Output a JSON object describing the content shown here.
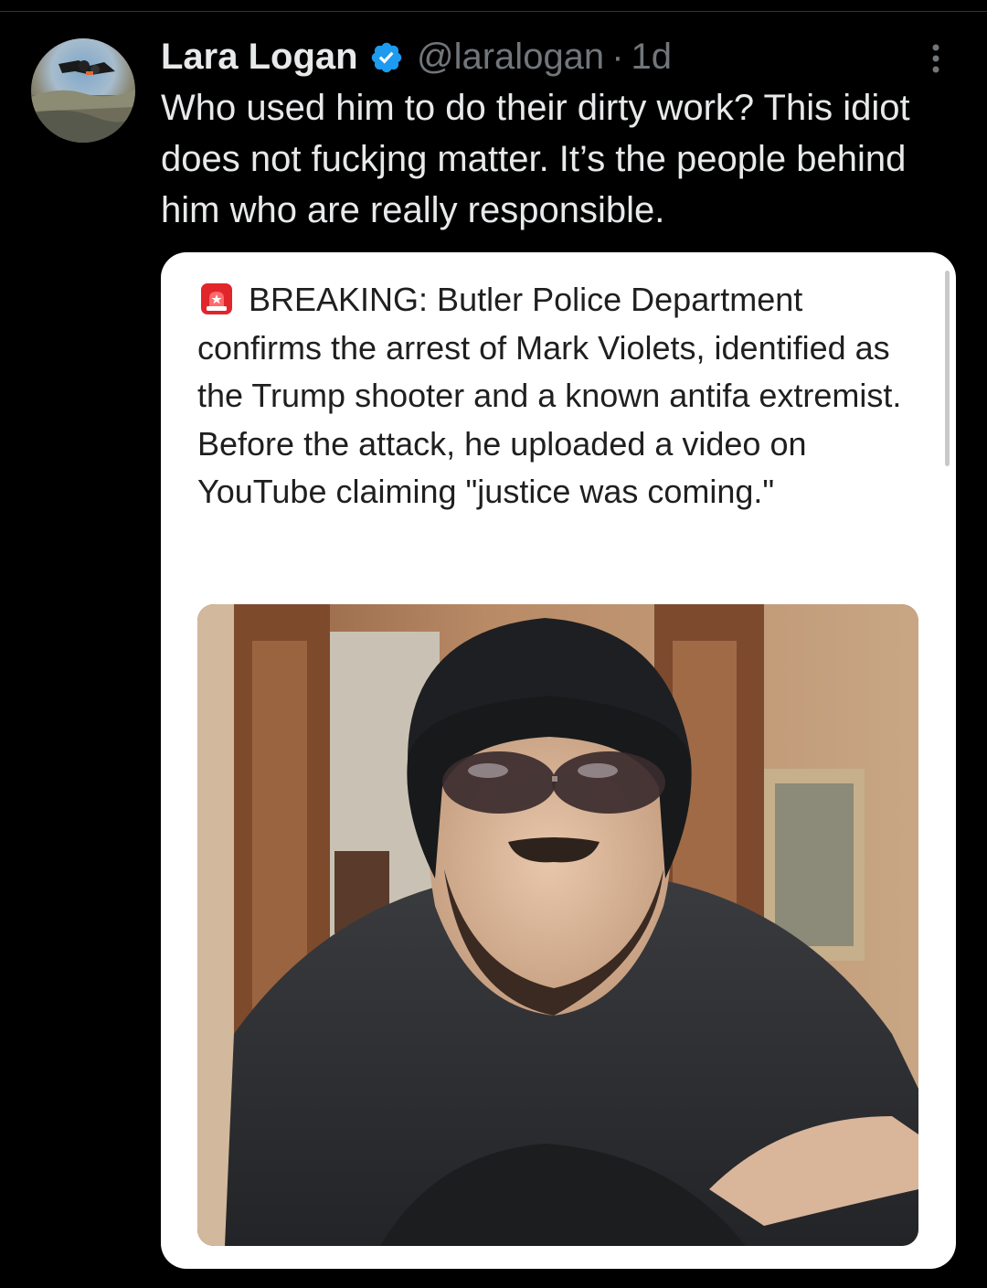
{
  "tweet": {
    "author_name": "Lara Logan",
    "handle": "@laralogan",
    "separator": "·",
    "time": "1d",
    "text": "Who used him to do their dirty work? This idiot does not fuckjng matter. It’s the people behind him who are really responsible.",
    "verified_icon": "verified-badge-icon",
    "more_icon": "more-options-icon"
  },
  "quote": {
    "emoji_icon": "siren-icon",
    "text": "BREAKING: Butler Police Department confirms the arrest of Mark Violets, identified as the Trump shooter and a known antifa extremist. Before the attack, he uploaded a video on YouTube claiming \"justice was coming.\""
  },
  "colors": {
    "background": "#000000",
    "text_primary": "#e7e9ea",
    "text_secondary": "#71767b",
    "verified_blue": "#1d9bf0",
    "card_background": "#ffffff",
    "card_text": "#1f1f1f"
  }
}
